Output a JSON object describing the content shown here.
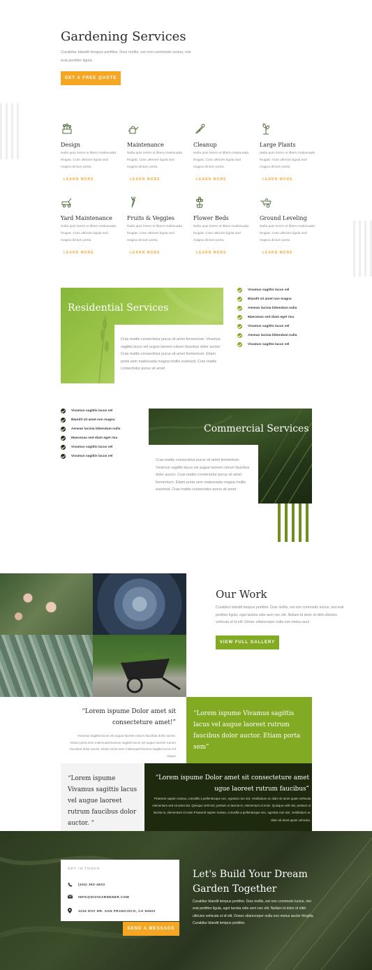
{
  "hero": {
    "title": "Gardening Services",
    "text": "Curabitur blandit tempus porttitor. Duis mollis, est non commodo luctus, nisi erat porttitor ligula.",
    "button": "GET A FREE QUOTE"
  },
  "services": [
    {
      "title": "Design",
      "icon": "gardening-tools-icon",
      "text": "Nulla quis lorem ut libero malesuada feugiat. Cras ultricies ligula sed magna dictum porta.",
      "link": "LEARN MORE"
    },
    {
      "title": "Maintenance",
      "icon": "watering-can-icon",
      "text": "Nulla quis lorem ut libero malesuada feugiat. Cras ultricies ligula sed magna dictum porta.",
      "link": "LEARN MORE"
    },
    {
      "title": "Cleanup",
      "icon": "shears-icon",
      "text": "Nulla quis lorem ut libero malesuada feugiat. Cras ultricies ligula sed magna dictum porta.",
      "link": "LEARN MORE"
    },
    {
      "title": "Large Plants",
      "icon": "tree-icon",
      "text": "Nulla quis lorem ut libero malesuada feugiat. Cras ultricies ligula sed magna dictum porta.",
      "link": "LEARN MORE"
    },
    {
      "title": "Yard Maintenance",
      "icon": "lawnmower-icon",
      "text": "Nulla quis lorem ut libero malesuada feugiat. Cras ultricies ligula sed magna dictum porta.",
      "link": "LEARN MORE"
    },
    {
      "title": "Fruits & Veggies",
      "icon": "carrot-icon",
      "text": "Nulla quis lorem ut libero malesuada feugiat. Cras ultricies ligula sed magna dictum porta.",
      "link": "LEARN MORE"
    },
    {
      "title": "Flower Beds",
      "icon": "flower-icon",
      "text": "Nulla quis lorem ut libero malesuada feugiat. Cras ultricies ligula sed magna dictum porta.",
      "link": "LEARN MORE"
    },
    {
      "title": "Ground Leveling",
      "icon": "wheelbarrow-icon",
      "text": "Nulla quis lorem ut libero malesuada feugiat. Cras ultricies ligula sed magna dictum porta.",
      "link": "LEARN MORE"
    }
  ],
  "residential": {
    "title": "Residential Services",
    "text": "Cras mattis consectetur purus sit amet fermentum. Vivamus sagittis lacus vel augue laoreet rutrum faucibus dolor auctor. Cras mattis consectetur purus sit amet fermentum. Etiam porta sem malesuada magna mollis euismod. Cras mattis consectetur purus sit amet",
    "list": [
      "Vivamus sagittis lacus vel",
      "Blandit sit amet non magna",
      "Aenean lacinia bibendum nulla",
      "Maecenas sed diam eget risu",
      "Vivamus sagittis lacus vel",
      "Aenean lacinia bibendum nulla",
      "Vivamus sagittis lacus vel"
    ]
  },
  "commercial": {
    "title": "Commercial Services",
    "text": "Cras mattis consectetur purus sit amet fermentum. Vivamus sagittis lacus vel augue laoreet rutrum faucibus dolor auctor. Cras mattis consectetur purus sit amet fermentum. Etiam porta sem malesuada magna mollis euismod. Cras mattis consectetur purus sit amet",
    "list": [
      "Vivamus sagittis lacus vel",
      "Blandit sit amet non magna",
      "Aenean lacinia bibendum nulla",
      "Maecenas sed diam eget risu",
      "Vivamus sagittis lacus vel",
      "Vivamus sagittis lacus vel"
    ]
  },
  "work": {
    "title": "Our Work",
    "text": "Curabitur blandit tempus porttitor. Duis mollis, est non commodo luctus, nisi erat porttitor ligula, eget lacinia odio sem nec elit. Nullam id dolor id nibh ultricies vehicula ut id elit. Donec ullamcorper nulla non metus auct",
    "button": "VIEW FULL GALLERY"
  },
  "testimonials": {
    "t1_quote": "“Lorem ispume Dolor amet sit consecteture amet!”",
    "t1_text": "Vivamus sagittis lacus vel augue laoreet rutrum faucibus dolor auctor. Etiam porta sem malesuadVivamus sagittis lacus vel augue laoreet rutrum faucibus dolor auctor. Etiam porta sem malesuadVivamus sagittis lacus vel augue",
    "t2_quote": "“Lorem ispume Vivamus sagittis lacus vel augue laoreet rutrum faucibus dolor auctor. Etiam porta sem”",
    "t3_quote": "“Lorem ispume Vivamus sagittis lacus vel augue laoreet rutrum faucibus dolor auctor. “",
    "t4_quote": "“Lorem ispume Dolor amet sit consecteture amet ugue laoreet rutrum faucibus”",
    "t4_text": "Praesent sapien massa, convallis a pellentesque nec, egestas non nisi. Vestibulum ac diam sit amet quam vehicula elementum sed sit amet dui. Quisque velit nisi, pretium ut lacinia in, elementum id enim. Quisque velit nisi, pretium ut lacinia in, elementum id enim.Praesent sapien massa, convallis a pellentesque nec, egestas non nisi. Vestibulum ac diam sit amet quam vehicula."
  },
  "contact": {
    "heading": "GET IN TOUCH",
    "phone": "(344) 362-4633",
    "email": "INFO@DIVIGARDENER.COM",
    "address": "1234 DIVI DR. SAN FRANCISCO, CA 93522",
    "button": "SEND A MESSAGE",
    "cta_title": "Let's Build Your Dream Garden Together",
    "cta_text": "Curabitur blandit tempus porttitor. Duis mollis, est non commodo luctus, nisi erat porttitor ligula, eget lacinia odio sem nec elit. Nullam id dolor id nibh ultricies vehicula ut id elit. Donec ullamcorper nulla non metus auctor fringilla. Curabitur blandit tempus porttitor."
  },
  "colors": {
    "accent_orange": "#f5a623",
    "accent_green": "#82aa22",
    "dark_green": "#1d2a0e"
  }
}
